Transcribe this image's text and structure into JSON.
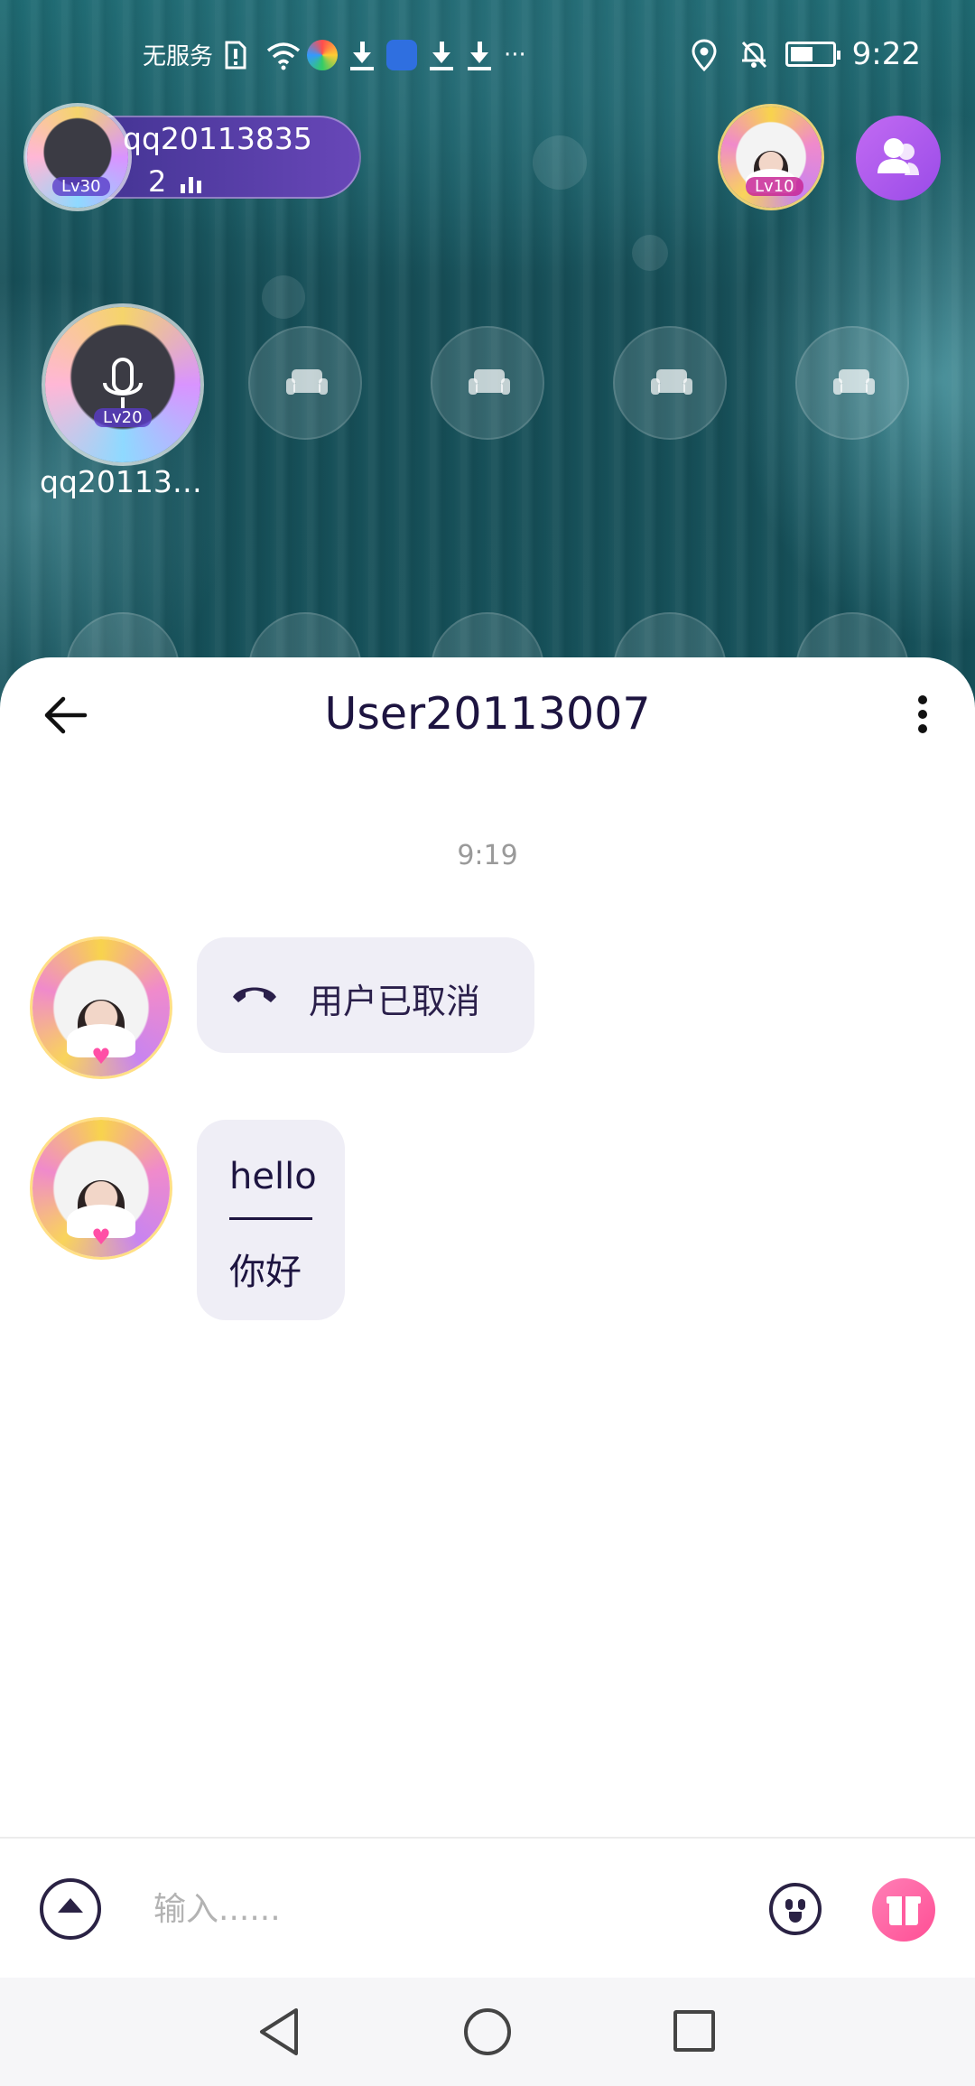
{
  "status_bar": {
    "carrier": "无服务",
    "time": "9:22"
  },
  "room": {
    "host": {
      "name": "qq20113835",
      "count": "2",
      "level": "Lv30"
    },
    "owner_level": "Lv10",
    "mic_seat": {
      "name": "qq201138…",
      "level": "Lv20"
    },
    "empty_seat_count": 4
  },
  "chat": {
    "title": "User20113007",
    "timestamp": "9:19",
    "messages": [
      {
        "type": "call",
        "text": "用户已取消",
        "icon": "phone-hangup-icon"
      },
      {
        "type": "translation",
        "original": "hello",
        "translation": "你好"
      }
    ],
    "input": {
      "placeholder": "输入......",
      "value": ""
    }
  },
  "colors": {
    "room_bg": "#1f6b73",
    "title": "#1d1440",
    "bubble": "#efeef6",
    "profile_button": "#b35df0",
    "gift_button": "#ff5c9f"
  },
  "icons": {
    "back": "arrow-left-icon",
    "more": "more-vertical-icon",
    "expand": "expand-up-icon",
    "emoji": "emoji-icon",
    "gift": "gift-icon",
    "profile": "user-group-icon",
    "seat": "sofa-icon"
  }
}
